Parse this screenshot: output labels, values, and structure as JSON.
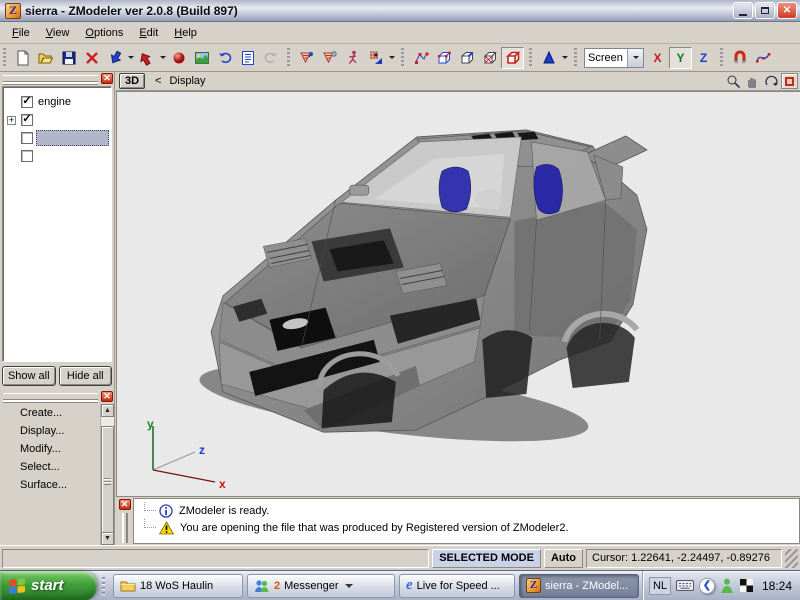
{
  "window": {
    "title": "sierra - ZModeler ver 2.0.8 (Build 897)",
    "app_icon_letter": "Z"
  },
  "menu": {
    "items": [
      "File",
      "View",
      "Options",
      "Edit",
      "Help"
    ]
  },
  "toolbar": {
    "plane_label": "Screen",
    "axis_buttons": [
      "X",
      "Y",
      "Z"
    ],
    "pressed_axis": "Y",
    "icons": [
      "new-file",
      "open-file",
      "save-file",
      "delete",
      "import",
      "export",
      "material-editor",
      "texture-browser",
      "undo",
      "log",
      "redo",
      "select-pin-active",
      "select-pin",
      "animate-runner",
      "light-tool",
      "vertices-mode",
      "cube-vertices-mode",
      "cube-edges-mode",
      "cube-polygons-mode",
      "cube-objects-mode",
      "cone-tool",
      "snap-magnet",
      "spline-tool"
    ]
  },
  "viewport": {
    "mode_button": "3D",
    "nav_back": "<",
    "location": "Display",
    "header_icons": [
      "zoom-icon",
      "pan-hand-icon",
      "orbit-icon",
      "maximize-view-icon"
    ],
    "background": "#e9e9e9",
    "axis_labels": {
      "x": "x",
      "y": "y",
      "z": "z"
    },
    "model": "gray Ford Sierra RS500 body with blue seats, no wheels"
  },
  "scene": {
    "items": [
      {
        "label": "engine",
        "checked": true,
        "expandable": false,
        "selected": false
      },
      {
        "label": "",
        "checked": true,
        "expandable": true,
        "selected": false
      },
      {
        "label": "",
        "checked": false,
        "expandable": false,
        "selected": true
      },
      {
        "label": "",
        "checked": false,
        "expandable": false,
        "selected": false
      }
    ],
    "show_all_label": "Show all",
    "hide_all_label": "Hide all"
  },
  "tools": {
    "items": [
      "Create...",
      "Display...",
      "Modify...",
      "Select...",
      "Surface..."
    ]
  },
  "messages": {
    "items": [
      {
        "type": "info",
        "text": "ZModeler is ready."
      },
      {
        "type": "warning",
        "text": "You are opening the file that was produced by Registered version of ZModeler2."
      }
    ]
  },
  "status": {
    "mode": "SELECTED MODE",
    "auto": "Auto",
    "cursor": "Cursor: 1.22641, -2.24497, -0.89276"
  },
  "taskbar": {
    "start_label": "start",
    "tasks": [
      {
        "label": "18 WoS Haulin",
        "icon": "folder",
        "active": false
      },
      {
        "label": "Messenger",
        "count": "2",
        "icon": "messenger",
        "active": false,
        "grouped": true
      },
      {
        "label": "Live for Speed ...",
        "icon": "internet-explorer",
        "active": false
      },
      {
        "label": "sierra - ZModel...",
        "icon": "zmodeler",
        "active": true
      }
    ],
    "tray": {
      "language": "NL",
      "icons": [
        "keyboard-icon",
        "hide-icons-chevron",
        "messenger-status-icon",
        "checker-app-icon"
      ],
      "clock": "18:24"
    }
  },
  "colors": {
    "chrome": "#d6d2ca",
    "close_button": "#c22c14",
    "selection_bar": "#b2b6c9",
    "start_button_green": "#3f9e3a",
    "seat_blue": "#3232ac",
    "car_body_gray": "#8a8a8a",
    "axis_x_red": "#c21b1b",
    "axis_y_green": "#0d7a1f",
    "axis_z_blue": "#1a3ccc"
  }
}
